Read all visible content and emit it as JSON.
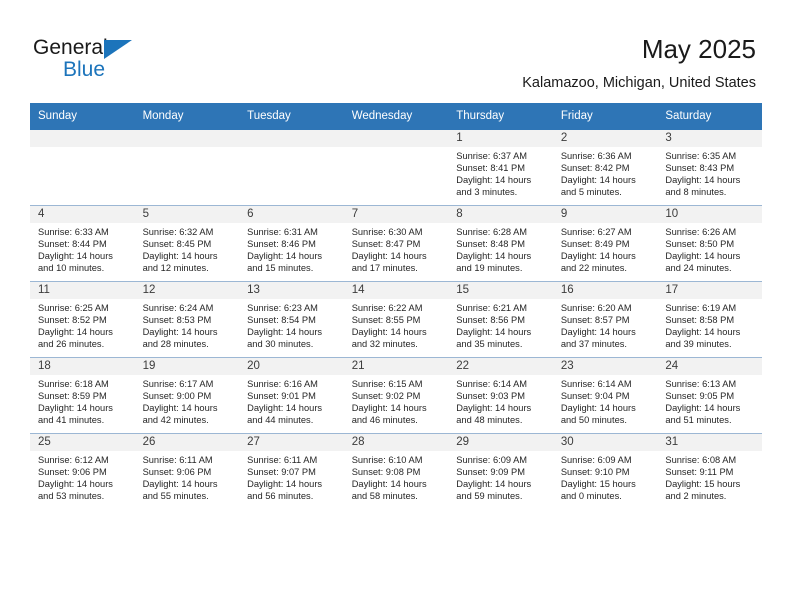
{
  "brand": {
    "logo_line1": "General",
    "logo_line2": "Blue",
    "logo_accent_color": "#1c74bb"
  },
  "header": {
    "title": "May 2025",
    "subtitle": "Kalamazoo, Michigan, United States"
  },
  "theme": {
    "header_row_bg": "#2e75b6",
    "day_band_bg": "#f2f2f2",
    "grid_line": "#9cb7d4"
  },
  "weekday_headers": [
    "Sunday",
    "Monday",
    "Tuesday",
    "Wednesday",
    "Thursday",
    "Friday",
    "Saturday"
  ],
  "weeks": [
    [
      {
        "day": "",
        "sunrise": "",
        "sunset": "",
        "daylight_line1": "",
        "daylight_line2": "",
        "empty": true
      },
      {
        "day": "",
        "sunrise": "",
        "sunset": "",
        "daylight_line1": "",
        "daylight_line2": "",
        "empty": true
      },
      {
        "day": "",
        "sunrise": "",
        "sunset": "",
        "daylight_line1": "",
        "daylight_line2": "",
        "empty": true
      },
      {
        "day": "",
        "sunrise": "",
        "sunset": "",
        "daylight_line1": "",
        "daylight_line2": "",
        "empty": true
      },
      {
        "day": "1",
        "sunrise": "Sunrise: 6:37 AM",
        "sunset": "Sunset: 8:41 PM",
        "daylight_line1": "Daylight: 14 hours",
        "daylight_line2": "and 3 minutes."
      },
      {
        "day": "2",
        "sunrise": "Sunrise: 6:36 AM",
        "sunset": "Sunset: 8:42 PM",
        "daylight_line1": "Daylight: 14 hours",
        "daylight_line2": "and 5 minutes."
      },
      {
        "day": "3",
        "sunrise": "Sunrise: 6:35 AM",
        "sunset": "Sunset: 8:43 PM",
        "daylight_line1": "Daylight: 14 hours",
        "daylight_line2": "and 8 minutes."
      }
    ],
    [
      {
        "day": "4",
        "sunrise": "Sunrise: 6:33 AM",
        "sunset": "Sunset: 8:44 PM",
        "daylight_line1": "Daylight: 14 hours",
        "daylight_line2": "and 10 minutes."
      },
      {
        "day": "5",
        "sunrise": "Sunrise: 6:32 AM",
        "sunset": "Sunset: 8:45 PM",
        "daylight_line1": "Daylight: 14 hours",
        "daylight_line2": "and 12 minutes."
      },
      {
        "day": "6",
        "sunrise": "Sunrise: 6:31 AM",
        "sunset": "Sunset: 8:46 PM",
        "daylight_line1": "Daylight: 14 hours",
        "daylight_line2": "and 15 minutes."
      },
      {
        "day": "7",
        "sunrise": "Sunrise: 6:30 AM",
        "sunset": "Sunset: 8:47 PM",
        "daylight_line1": "Daylight: 14 hours",
        "daylight_line2": "and 17 minutes."
      },
      {
        "day": "8",
        "sunrise": "Sunrise: 6:28 AM",
        "sunset": "Sunset: 8:48 PM",
        "daylight_line1": "Daylight: 14 hours",
        "daylight_line2": "and 19 minutes."
      },
      {
        "day": "9",
        "sunrise": "Sunrise: 6:27 AM",
        "sunset": "Sunset: 8:49 PM",
        "daylight_line1": "Daylight: 14 hours",
        "daylight_line2": "and 22 minutes."
      },
      {
        "day": "10",
        "sunrise": "Sunrise: 6:26 AM",
        "sunset": "Sunset: 8:50 PM",
        "daylight_line1": "Daylight: 14 hours",
        "daylight_line2": "and 24 minutes."
      }
    ],
    [
      {
        "day": "11",
        "sunrise": "Sunrise: 6:25 AM",
        "sunset": "Sunset: 8:52 PM",
        "daylight_line1": "Daylight: 14 hours",
        "daylight_line2": "and 26 minutes."
      },
      {
        "day": "12",
        "sunrise": "Sunrise: 6:24 AM",
        "sunset": "Sunset: 8:53 PM",
        "daylight_line1": "Daylight: 14 hours",
        "daylight_line2": "and 28 minutes."
      },
      {
        "day": "13",
        "sunrise": "Sunrise: 6:23 AM",
        "sunset": "Sunset: 8:54 PM",
        "daylight_line1": "Daylight: 14 hours",
        "daylight_line2": "and 30 minutes."
      },
      {
        "day": "14",
        "sunrise": "Sunrise: 6:22 AM",
        "sunset": "Sunset: 8:55 PM",
        "daylight_line1": "Daylight: 14 hours",
        "daylight_line2": "and 32 minutes."
      },
      {
        "day": "15",
        "sunrise": "Sunrise: 6:21 AM",
        "sunset": "Sunset: 8:56 PM",
        "daylight_line1": "Daylight: 14 hours",
        "daylight_line2": "and 35 minutes."
      },
      {
        "day": "16",
        "sunrise": "Sunrise: 6:20 AM",
        "sunset": "Sunset: 8:57 PM",
        "daylight_line1": "Daylight: 14 hours",
        "daylight_line2": "and 37 minutes."
      },
      {
        "day": "17",
        "sunrise": "Sunrise: 6:19 AM",
        "sunset": "Sunset: 8:58 PM",
        "daylight_line1": "Daylight: 14 hours",
        "daylight_line2": "and 39 minutes."
      }
    ],
    [
      {
        "day": "18",
        "sunrise": "Sunrise: 6:18 AM",
        "sunset": "Sunset: 8:59 PM",
        "daylight_line1": "Daylight: 14 hours",
        "daylight_line2": "and 41 minutes."
      },
      {
        "day": "19",
        "sunrise": "Sunrise: 6:17 AM",
        "sunset": "Sunset: 9:00 PM",
        "daylight_line1": "Daylight: 14 hours",
        "daylight_line2": "and 42 minutes."
      },
      {
        "day": "20",
        "sunrise": "Sunrise: 6:16 AM",
        "sunset": "Sunset: 9:01 PM",
        "daylight_line1": "Daylight: 14 hours",
        "daylight_line2": "and 44 minutes."
      },
      {
        "day": "21",
        "sunrise": "Sunrise: 6:15 AM",
        "sunset": "Sunset: 9:02 PM",
        "daylight_line1": "Daylight: 14 hours",
        "daylight_line2": "and 46 minutes."
      },
      {
        "day": "22",
        "sunrise": "Sunrise: 6:14 AM",
        "sunset": "Sunset: 9:03 PM",
        "daylight_line1": "Daylight: 14 hours",
        "daylight_line2": "and 48 minutes."
      },
      {
        "day": "23",
        "sunrise": "Sunrise: 6:14 AM",
        "sunset": "Sunset: 9:04 PM",
        "daylight_line1": "Daylight: 14 hours",
        "daylight_line2": "and 50 minutes."
      },
      {
        "day": "24",
        "sunrise": "Sunrise: 6:13 AM",
        "sunset": "Sunset: 9:05 PM",
        "daylight_line1": "Daylight: 14 hours",
        "daylight_line2": "and 51 minutes."
      }
    ],
    [
      {
        "day": "25",
        "sunrise": "Sunrise: 6:12 AM",
        "sunset": "Sunset: 9:06 PM",
        "daylight_line1": "Daylight: 14 hours",
        "daylight_line2": "and 53 minutes."
      },
      {
        "day": "26",
        "sunrise": "Sunrise: 6:11 AM",
        "sunset": "Sunset: 9:06 PM",
        "daylight_line1": "Daylight: 14 hours",
        "daylight_line2": "and 55 minutes."
      },
      {
        "day": "27",
        "sunrise": "Sunrise: 6:11 AM",
        "sunset": "Sunset: 9:07 PM",
        "daylight_line1": "Daylight: 14 hours",
        "daylight_line2": "and 56 minutes."
      },
      {
        "day": "28",
        "sunrise": "Sunrise: 6:10 AM",
        "sunset": "Sunset: 9:08 PM",
        "daylight_line1": "Daylight: 14 hours",
        "daylight_line2": "and 58 minutes."
      },
      {
        "day": "29",
        "sunrise": "Sunrise: 6:09 AM",
        "sunset": "Sunset: 9:09 PM",
        "daylight_line1": "Daylight: 14 hours",
        "daylight_line2": "and 59 minutes."
      },
      {
        "day": "30",
        "sunrise": "Sunrise: 6:09 AM",
        "sunset": "Sunset: 9:10 PM",
        "daylight_line1": "Daylight: 15 hours",
        "daylight_line2": "and 0 minutes."
      },
      {
        "day": "31",
        "sunrise": "Sunrise: 6:08 AM",
        "sunset": "Sunset: 9:11 PM",
        "daylight_line1": "Daylight: 15 hours",
        "daylight_line2": "and 2 minutes."
      }
    ]
  ]
}
